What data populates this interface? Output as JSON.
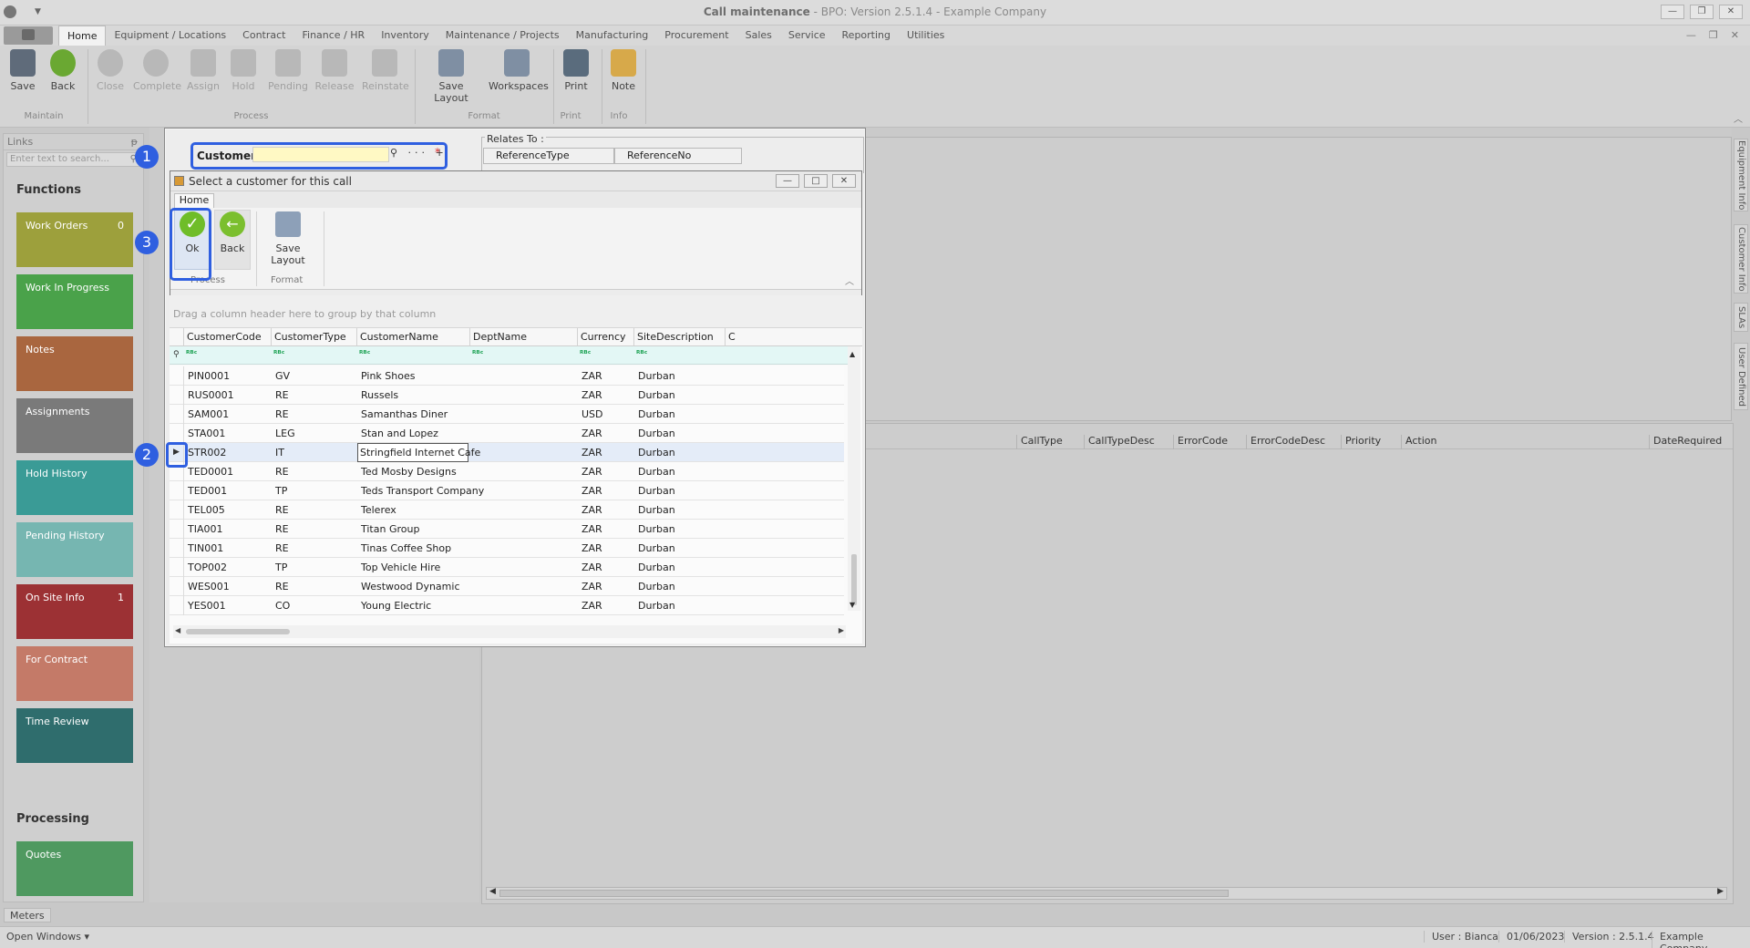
{
  "window": {
    "title_main": "Call maintenance",
    "title_rest": " - BPO: Version 2.5.1.4 - Example Company",
    "buttons": [
      "—",
      "❐",
      "✕"
    ]
  },
  "menu": {
    "tabs": [
      "Home",
      "Equipment / Locations",
      "Contract",
      "Finance / HR",
      "Inventory",
      "Maintenance / Projects",
      "Manufacturing",
      "Procurement",
      "Sales",
      "Service",
      "Reporting",
      "Utilities"
    ],
    "mdi_buttons": [
      "—",
      "❐",
      "✕"
    ]
  },
  "ribbon": {
    "buttons": [
      {
        "label": "Save",
        "icon": "save-icon"
      },
      {
        "label": "Back",
        "icon": "back-icon"
      },
      {
        "label": "Close",
        "icon": "close-icon"
      },
      {
        "label": "Complete",
        "icon": "complete-icon"
      },
      {
        "label": "Assign",
        "icon": "assign-icon"
      },
      {
        "label": "Hold",
        "icon": "hold-icon"
      },
      {
        "label": "Pending",
        "icon": "pending-icon"
      },
      {
        "label": "Release",
        "icon": "release-icon"
      },
      {
        "label": "Reinstate",
        "icon": "reinstate-icon"
      },
      {
        "label": "Save Layout",
        "icon": "save-layout-icon"
      },
      {
        "label": "Workspaces",
        "icon": "workspaces-icon"
      },
      {
        "label": "Print",
        "icon": "print-icon"
      },
      {
        "label": "Note",
        "icon": "note-icon"
      }
    ],
    "groups": [
      "Maintain",
      "Process",
      "Format",
      "Print",
      "Info"
    ]
  },
  "links_panel": {
    "title": "Links",
    "search_placeholder": "Enter text to search...",
    "functions_title": "Functions",
    "processing_title": "Processing",
    "tiles": [
      {
        "label": "Work Orders",
        "count": "0",
        "color": "#9da03c"
      },
      {
        "label": "Work In Progress",
        "count": "",
        "color": "#4aa24a"
      },
      {
        "label": "Notes",
        "count": "",
        "color": "#a9663f"
      },
      {
        "label": "Assignments",
        "count": "",
        "color": "#7a7a7a"
      },
      {
        "label": "Hold History",
        "count": "",
        "color": "#3a9b96"
      },
      {
        "label": "Pending History",
        "count": "",
        "color": "#76b6b1"
      },
      {
        "label": "On Site Info",
        "count": "1",
        "color": "#9c3134"
      },
      {
        "label": "For Contract",
        "count": "",
        "color": "#c47a68"
      },
      {
        "label": "Time Review",
        "count": "",
        "color": "#2f6d6d"
      }
    ],
    "processing_tiles": [
      {
        "label": "Quotes",
        "color": "#4f9960"
      }
    ]
  },
  "right_tabs": [
    "Equipment Info",
    "Customer Info",
    "SLAs",
    "User Defined"
  ],
  "form": {
    "customer_label": "Customer",
    "customer_tools": "⚲ ··· +",
    "required_mark": "*",
    "relates_label": "Relates To :",
    "ref_headers": [
      "ReferenceType",
      "ReferenceNo"
    ]
  },
  "lower_grid_headers": [
    "CallType",
    "CallTypeDesc",
    "ErrorCode",
    "ErrorCodeDesc",
    "Priority",
    "Action",
    "DateRequired"
  ],
  "dialog": {
    "title": "Select a customer for this call",
    "tab": "Home",
    "buttons": [
      {
        "label": "Ok",
        "icon": "ok-icon"
      },
      {
        "label": "Back",
        "icon": "back-icon"
      },
      {
        "label": "Save Layout",
        "icon": "save-layout-icon"
      }
    ],
    "groups": [
      "Process",
      "Format"
    ],
    "group_panel_text": "Drag a column header here to group by that column",
    "columns": [
      "CustomerCode",
      "CustomerType",
      "CustomerName",
      "DeptName",
      "Currency",
      "SiteDescription",
      "C"
    ],
    "filter_glyph": "ᴿᴮᶜ",
    "rows": [
      [
        "PIN0001",
        "GV",
        "Pink Shoes",
        "",
        "ZAR",
        "Durban"
      ],
      [
        "RUS0001",
        "RE",
        "Russels",
        "",
        "ZAR",
        "Durban"
      ],
      [
        "SAM001",
        "RE",
        "Samanthas Diner",
        "",
        "USD",
        "Durban"
      ],
      [
        "STA001",
        "LEG",
        "Stan and Lopez",
        "",
        "ZAR",
        "Durban"
      ],
      [
        "STR002",
        "IT",
        "Stringfield Internet Cafe",
        "",
        "ZAR",
        "Durban"
      ],
      [
        "TED0001",
        "RE",
        "Ted Mosby Designs",
        "",
        "ZAR",
        "Durban"
      ],
      [
        "TED001",
        "TP",
        "Teds Transport Company",
        "",
        "ZAR",
        "Durban"
      ],
      [
        "TEL005",
        "RE",
        "Telerex",
        "",
        "ZAR",
        "Durban"
      ],
      [
        "TIA001",
        "RE",
        "Titan Group",
        "",
        "ZAR",
        "Durban"
      ],
      [
        "TIN001",
        "RE",
        "Tinas Coffee Shop",
        "",
        "ZAR",
        "Durban"
      ],
      [
        "TOP002",
        "TP",
        "Top Vehicle Hire",
        "",
        "ZAR",
        "Durban"
      ],
      [
        "WES001",
        "RE",
        "Westwood Dynamic",
        "",
        "ZAR",
        "Durban"
      ],
      [
        "YES001",
        "CO",
        "Young Electric",
        "",
        "ZAR",
        "Durban"
      ]
    ],
    "selected_row": 4
  },
  "badges": [
    "1",
    "2",
    "3"
  ],
  "bottom": {
    "meters_tab": "Meters",
    "open_windows": "Open Windows ▾",
    "user": "User : Bianca",
    "date": "01/06/2023",
    "version": "Version : 2.5.1.4",
    "company": "Example Company"
  }
}
